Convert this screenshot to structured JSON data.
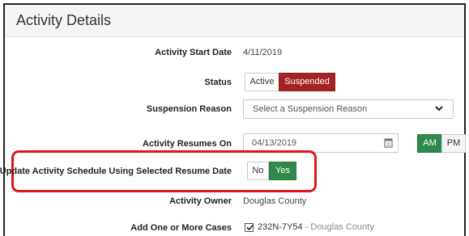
{
  "panel": {
    "title": "Activity Details"
  },
  "fields": {
    "start_date": {
      "label": "Activity Start Date",
      "value": "4/11/2019"
    },
    "status": {
      "label": "Status",
      "options": [
        "Active",
        "Suspended"
      ],
      "selected": "Suspended"
    },
    "suspension_reason": {
      "label": "Suspension Reason",
      "placeholder": "Select a Suspension Reason"
    },
    "resumes_on": {
      "label": "Activity Resumes On",
      "value": "04/13/2019",
      "am": "AM",
      "pm": "PM",
      "selected_period": "AM"
    },
    "update_schedule": {
      "label": "Update Activity Schedule Using Selected Resume Date",
      "no": "No",
      "yes": "Yes",
      "selected": "Yes"
    },
    "owner": {
      "label": "Activity Owner",
      "value": "Douglas County"
    },
    "cases": {
      "label": "Add One or More Cases",
      "case_id": "232N-7Y54",
      "case_suffix": " - Douglas County",
      "checked": true
    }
  },
  "colors": {
    "active_red": "#a52325",
    "active_green": "#2f8a4b",
    "highlight": "#e11515"
  },
  "icons": {
    "dropdown": "chevron-down-icon",
    "calendar": "calendar-icon",
    "checkbox": "check-icon"
  }
}
